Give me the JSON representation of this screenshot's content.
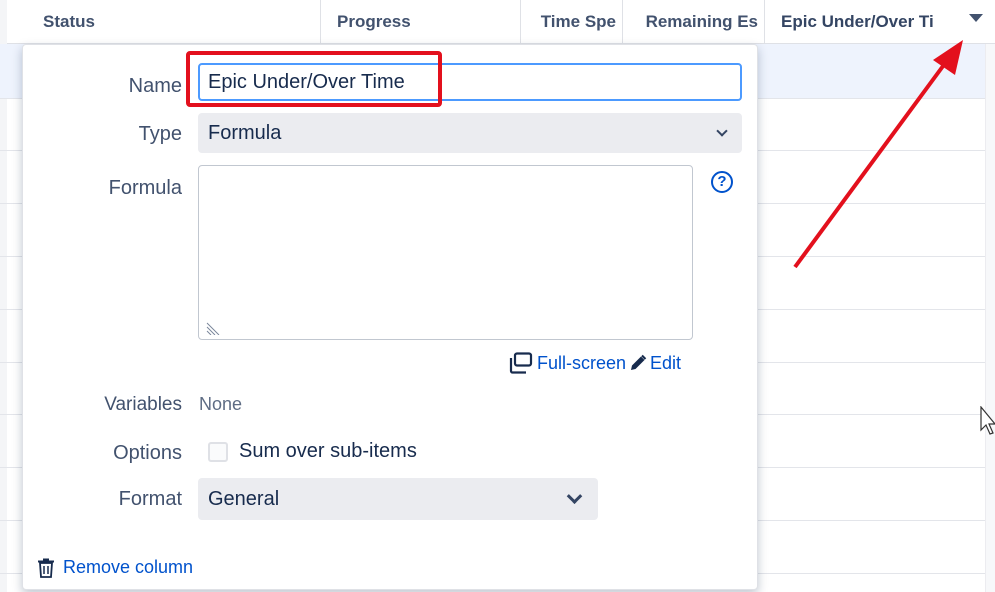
{
  "table": {
    "columns": [
      {
        "label": "Status"
      },
      {
        "label": "Progress"
      },
      {
        "label": "Time Spe"
      },
      {
        "label": "Remaining Es"
      },
      {
        "label": "Epic Under/Over Ti"
      }
    ]
  },
  "panel": {
    "name_label": "Name",
    "name_value": "Epic Under/Over Time",
    "type_label": "Type",
    "type_value": "Formula",
    "formula_label": "Formula",
    "formula_value": "",
    "help_icon": "?",
    "fullscreen_link": "Full-screen",
    "edit_link": "Edit",
    "variables_label": "Variables",
    "variables_value": "None",
    "options_label": "Options",
    "sum_checkbox_label": "Sum over sub-items",
    "sum_checkbox_checked": false,
    "format_label": "Format",
    "format_value": "General",
    "remove_link": "Remove column"
  },
  "icons": {
    "fullscreen": "window-icon",
    "edit": "pencil-icon",
    "remove": "trash-icon",
    "help": "question-circle-icon",
    "column_menu": "caret-down-icon"
  },
  "colors": {
    "link": "#0052cc",
    "focus": "#4c9aff",
    "annotation": "#e3101d"
  }
}
